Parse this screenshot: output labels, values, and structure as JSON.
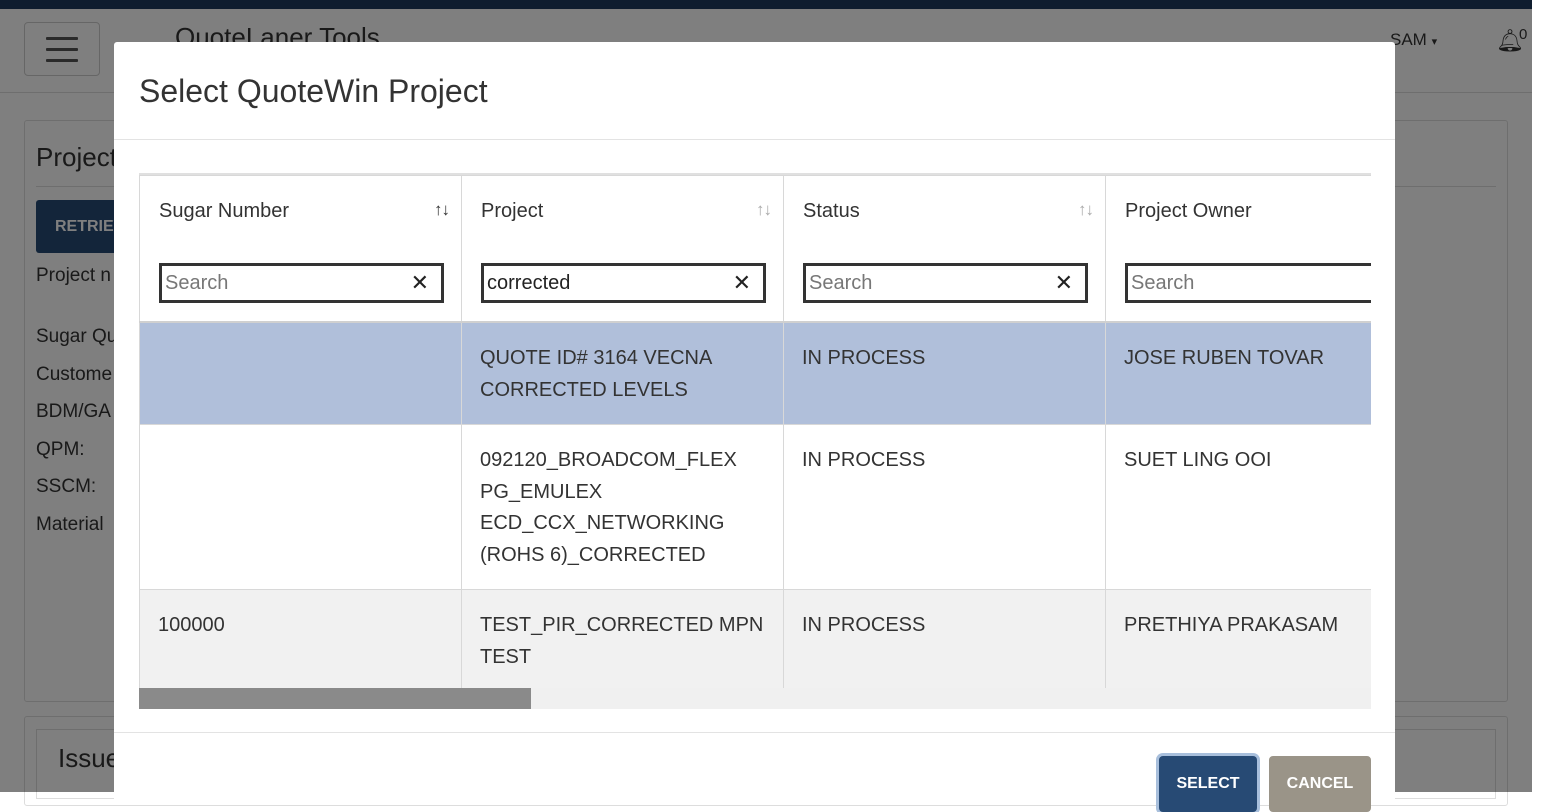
{
  "app": {
    "title": "QuoteLaner Tools",
    "user_label": "SAM",
    "notification_count": "0"
  },
  "background": {
    "card_title": "Project",
    "retrieve_label": "RETRIEVE",
    "project_label": "Project n",
    "fields": [
      "Sugar Qu",
      "Custome",
      "BDM/GA",
      "QPM:",
      "SSCM:",
      "Material"
    ],
    "issues_title": "Issues"
  },
  "modal": {
    "title": "Select QuoteWin Project",
    "columns": [
      {
        "label": "Sugar Number",
        "filter_value": "",
        "placeholder": "Search"
      },
      {
        "label": "Project",
        "filter_value": "corrected",
        "placeholder": "Search"
      },
      {
        "label": "Status",
        "filter_value": "",
        "placeholder": "Search"
      },
      {
        "label": "Project Owner",
        "filter_value": "",
        "placeholder": "Search"
      }
    ],
    "rows": [
      {
        "sugar_number": "",
        "project": "QUOTE ID# 3164 VECNA CORRECTED LEVELS",
        "status": "IN PROCESS",
        "owner": "JOSE RUBEN TOVAR",
        "selected": true
      },
      {
        "sugar_number": "",
        "project": "092120_BROADCOM_FLEX PG_EMULEX ECD_CCX_NETWORKING (ROHS 6)_CORRECTED",
        "status": "IN PROCESS",
        "owner": "SUET LING OOI",
        "selected": false
      },
      {
        "sugar_number": "100000",
        "project": "TEST_PIR_CORRECTED MPN TEST",
        "status": "IN PROCESS",
        "owner": "PRETHIYA PRAKASAM",
        "selected": false
      }
    ],
    "select_label": "SELECT",
    "cancel_label": "CANCEL"
  },
  "icons": {
    "sort": "sort-icon",
    "clear": "clear-icon",
    "menu": "hamburger-icon",
    "bell": "bell-icon"
  },
  "colors": {
    "primary": "#274a74",
    "selected_row": "#b0bfda",
    "cancel": "#9a9488"
  }
}
